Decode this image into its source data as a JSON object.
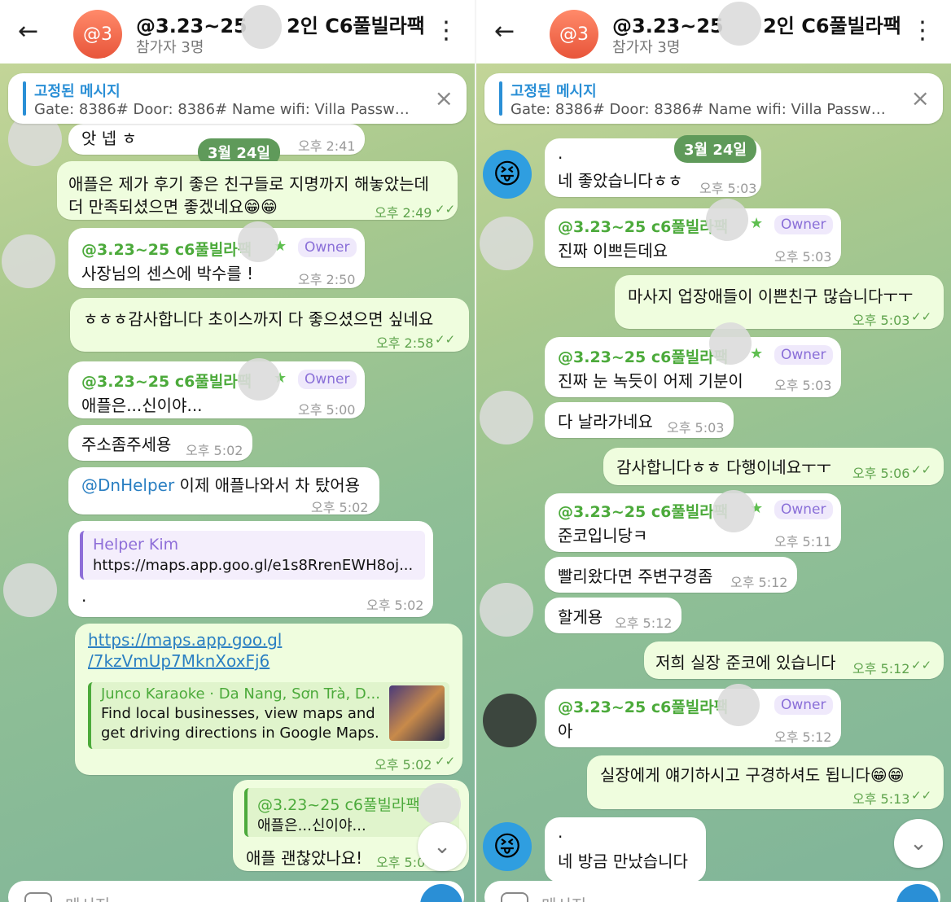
{
  "left": {
    "header": {
      "back": "←",
      "avatar_text": "@3",
      "title": "@3.23~25 ",
      "title_suffix": "2인 C6풀빌라팩",
      "subtitle": "참가자 3명",
      "menu": "⋮"
    },
    "pinned": {
      "title": "고정된 메시지",
      "text": "Gate: 8386# Door: 8386# Name wifi: Villa Passwor...",
      "close": "×"
    },
    "messages": {
      "m0_text": "앗 넵 ㅎ",
      "m0_time": "오후 2:41",
      "date": "3월 24일",
      "m1_line1": "애플은 제가 후기 좋은 친구들로 지명까지 해놓았는데",
      "m1_line2": "더 만족되셨으면 좋겠네요😁😁",
      "m1_time": "오후 2:49",
      "m2_sender": "@3.23~25 c6풀빌라팩",
      "m2_badge": "Owner",
      "m2_text": "사장님의 센스에 박수를 !",
      "m2_time": "오후 2:50",
      "m3_text": "ㅎㅎㅎ감사합니다 초이스까지 다 좋으셨으면 싶네요",
      "m3_time": "오후 2:58",
      "m4_sender": "@3.23~25 c6풀빌라팩",
      "m4_badge": "Owner",
      "m4_text": "애플은...신이야...",
      "m4_time": "오후 5:00",
      "m5_text": "주소좀주세용",
      "m5_time": "오후 5:02",
      "m6_mention": "@DnHelper",
      "m6_text": " 이제 애플나와서 차 탔어용",
      "m6_time": "오후 5:02",
      "m7_reply_name": "Helper Kim",
      "m7_reply_text": "https://maps.app.goo.gl/e1s8RrenEWH8oj...",
      "m7_text": ".",
      "m7_time": "오후 5:02",
      "m8_link1": "https://maps.app.goo.gl",
      "m8_link2": "/7kzVmUp7MknXoxFj6",
      "m8_prev_title": "Junco Karaoke · Da Nang, Sơn Trà, D...",
      "m8_prev_line1": "Find local businesses, view maps and",
      "m8_prev_line2": "get driving directions in Google Maps.",
      "m8_time": "오후 5:02",
      "m9_reply_name": "@3.23~25 c6풀빌라팩",
      "m9_reply_text": "애플은...신이야...",
      "m9_text": "애플 괜찮았나요!",
      "m9_time": "오후 5:0"
    },
    "input_placeholder": "메시지"
  },
  "right": {
    "header": {
      "back": "←",
      "avatar_text": "@3",
      "title": "@3.23~25 ",
      "title_suffix": "2인 C6풀빌라팩",
      "subtitle": "참가자 3명",
      "menu": "⋮"
    },
    "pinned": {
      "title": "고정된 메시지",
      "text": "Gate: 8386# Door: 8386# Name wifi: Villa Passwor...",
      "close": "×"
    },
    "messages": {
      "date": "3월 24일",
      "r1_dot": ".",
      "r1_text": "네 좋았습니다ㅎㅎ",
      "r1_time": "오후 5:03",
      "r2_sender": "@3.23~25 c6풀빌라팩",
      "r2_badge": "Owner",
      "r2_text": "진짜 이쁘든데요",
      "r2_time": "오후 5:03",
      "r3_text": "마사지 업장애들이 이쁜친구 많습니다ㅜㅜ",
      "r3_time": "오후 5:03",
      "r4_sender": "@3.23~25 c6풀빌라팩",
      "r4_badge": "Owner",
      "r4_text": "진짜 눈 녹듯이 어제 기분이",
      "r4_time": "오후 5:03",
      "r5_text": "다 날라가네요",
      "r5_time": "오후 5:03",
      "r6_text": "감사합니다ㅎㅎ 다행이네요ㅜㅜ",
      "r6_time": "오후 5:06",
      "r7_sender": "@3.23~25 c6풀빌라팩",
      "r7_badge": "Owner",
      "r7_text": "준코입니당ㅋ",
      "r7_time": "오후 5:11",
      "r8_text": "빨리왔다면 주변구경좀",
      "r8_time": "오후 5:12",
      "r9_text": "할게용",
      "r9_time": "오후 5:12",
      "r10_text": "저희 실장 준코에 있습니다",
      "r10_time": "오후 5:12",
      "r11_sender": "@3.23~25 c6풀빌라팩",
      "r11_badge": "Owner",
      "r11_text": "아",
      "r11_time": "오후 5:12",
      "r12_text": "실장에게 얘기하시고 구경하셔도 됩니다😁😁",
      "r12_time": "오후 5:13",
      "r13_dot": ".",
      "r13_text": "네 방금 만났습니다"
    },
    "input_placeholder": "메시지"
  },
  "icons": {
    "check": "✓✓",
    "chevron": "⌄",
    "star": "★",
    "emoji_avatar": "😝"
  },
  "colors": {
    "accent": "#2a8fd6",
    "sender": "#4caa3b",
    "owner_badge": "#8a6fd8"
  }
}
